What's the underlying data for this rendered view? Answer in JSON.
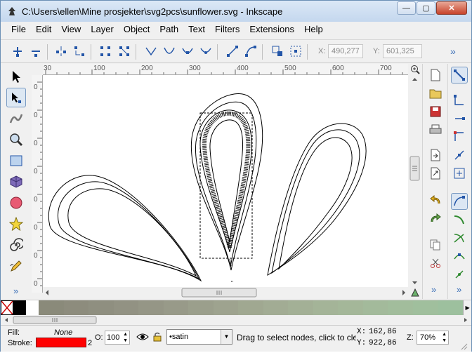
{
  "window": {
    "title": "C:\\Users\\ellen\\Mine prosjekter\\svg2pcs\\sunflower.svg - Inkscape",
    "controls": {
      "minimize": "—",
      "maximize": "▢",
      "close": "✕"
    }
  },
  "menu": [
    "File",
    "Edit",
    "View",
    "Layer",
    "Object",
    "Path",
    "Text",
    "Filters",
    "Extensions",
    "Help"
  ],
  "node_toolbar": {
    "x_label": "X:",
    "x_value": "490,277",
    "y_label": "Y:",
    "y_value": "601,325",
    "overflow": "»"
  },
  "rulers": {
    "horizontal": [
      "30",
      "100",
      "200",
      "300",
      "400",
      "500",
      "600",
      "700"
    ],
    "vertical": [
      "0",
      "0",
      "0",
      "0",
      "0",
      "0",
      "0",
      "0"
    ]
  },
  "toolbox_more": "»",
  "right_more": "»",
  "status": {
    "fill_label": "Fill:",
    "fill_value": "None",
    "stroke_label": "Stroke:",
    "stroke_width": "2",
    "stroke_color": "#ff0000",
    "opacity_label": "O:",
    "opacity_value": "100",
    "layer_name": "•satin",
    "message": "Drag to select nodes, click to clear the selection",
    "cursor_x_label": "X:",
    "cursor_x": "162,86",
    "cursor_y_label": "Y:",
    "cursor_y": "922,86",
    "zoom_label": "Z:",
    "zoom_value": "70%"
  },
  "palette": [
    "#000000",
    "#ffffff",
    "#8a8a7a",
    "#8d8c7d",
    "#8f8f80",
    "#929283",
    "#959686",
    "#989a89",
    "#9b9f8c",
    "#9ea38f",
    "#a0a891",
    "#a2ac94",
    "#a3b096",
    "#a4b498",
    "#a4b799",
    "#a3ba9b",
    "#a2bd9c",
    "#a0bf9d",
    "#9dc09e"
  ],
  "colors": {
    "accent": "#3a6fb8",
    "selection_hint": "#ffffff"
  }
}
